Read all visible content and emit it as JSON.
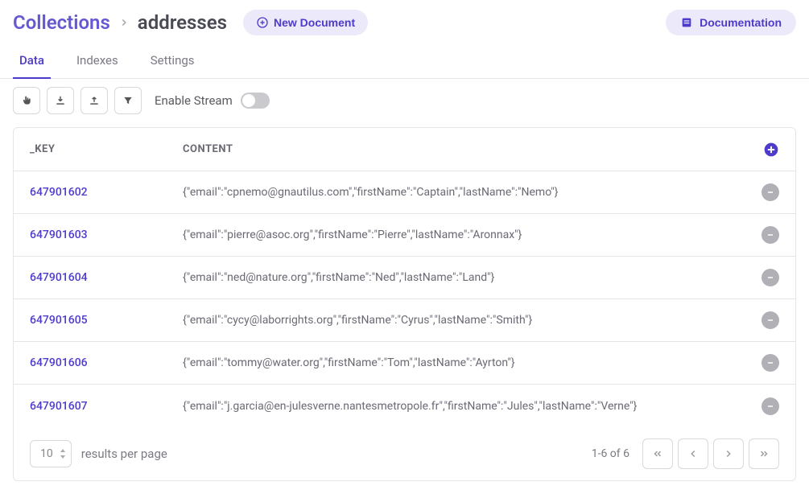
{
  "header": {
    "breadcrumb_root": "Collections",
    "breadcrumb_current": "addresses",
    "new_document_label": "New Document",
    "documentation_label": "Documentation"
  },
  "tabs": [
    {
      "label": "Data",
      "active": true
    },
    {
      "label": "Indexes",
      "active": false
    },
    {
      "label": "Settings",
      "active": false
    }
  ],
  "toolbar": {
    "enable_stream_label": "Enable Stream",
    "stream_enabled": false
  },
  "table": {
    "columns": {
      "key": "_KEY",
      "content": "CONTENT"
    },
    "rows": [
      {
        "key": "647901602",
        "content": "{\"email\":\"cpnemo@gnautilus.com\",\"firstName\":\"Captain\",\"lastName\":\"Nemo\"}"
      },
      {
        "key": "647901603",
        "content": "{\"email\":\"pierre@asoc.org\",\"firstName\":\"Pierre\",\"lastName\":\"Aronnax\"}"
      },
      {
        "key": "647901604",
        "content": "{\"email\":\"ned@nature.org\",\"firstName\":\"Ned\",\"lastName\":\"Land\"}"
      },
      {
        "key": "647901605",
        "content": "{\"email\":\"cycy@laborrights.org\",\"firstName\":\"Cyrus\",\"lastName\":\"Smith\"}"
      },
      {
        "key": "647901606",
        "content": "{\"email\":\"tommy@water.org\",\"firstName\":\"Tom\",\"lastName\":\"Ayrton\"}"
      },
      {
        "key": "647901607",
        "content": "{\"email\":\"j.garcia@en-julesverne.nantesmetropole.fr\",\"firstName\":\"Jules\",\"lastName\":\"Verne\"}"
      }
    ]
  },
  "pager": {
    "page_size": "10",
    "results_per_page_label": "results per page",
    "range_text": "1-6 of 6"
  }
}
